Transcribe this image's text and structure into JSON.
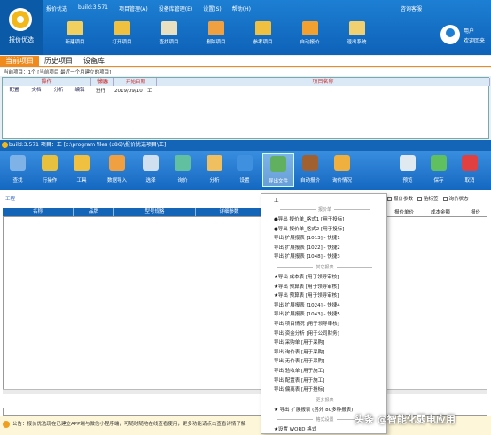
{
  "top_app": {
    "logo_text": "报价优选",
    "menu": [
      "报价优选",
      "build:3.571",
      "项目管理(A)",
      "设备库管理(E)",
      "设置(S)",
      "帮助(H)"
    ],
    "top_right": [
      "咨询客服"
    ],
    "toolbar": [
      "新建项目",
      "打开项目",
      "查找项目",
      "删除项目",
      "参考项目",
      "自动报价",
      "退出系统"
    ],
    "user_label": "用户",
    "user_greeting": "欢迎回来"
  },
  "tabs": [
    "当前项目",
    "历史项目",
    "设备库"
  ],
  "count_text": "当前项目：1个 [当前项目 最近一个月建立的项目]",
  "grid1": {
    "group_headers": [
      "操作",
      "状态",
      "项目名称"
    ],
    "sub_headers": [
      "配置",
      "文档",
      "分析",
      "编辑",
      "状态",
      "开始日期"
    ],
    "row": {
      "status": "进行",
      "date": "2019/09/10",
      "name": "工"
    }
  },
  "win2": {
    "title": "build:3.571  项目：工  [c:\\program files (x86)\\报价优选项目\\工]",
    "toolbar": [
      "查找",
      "行操作",
      "工具",
      "数据导入",
      "选择",
      "询价",
      "分析",
      "设置",
      "导出文件",
      "自动报价",
      "询价情况",
      "预览",
      "保存",
      "取消"
    ],
    "sub_label": "工程",
    "checks": [
      "报价参数",
      "贴标签",
      "询价状态"
    ],
    "grid_headers": [
      "名称",
      "品牌",
      "型号规格",
      "详细参数"
    ],
    "grid_headers_right": [
      "报价单价",
      "成本金额",
      "报价"
    ],
    "notice": "公告：报价优选现在已建立APP端与微信小程序端，可随时随地在线查看使用，更多功能请点击查看详情了解"
  },
  "dropdown": {
    "top_item": "工",
    "sections": [
      {
        "title": "报价单",
        "items": [
          "●导出 报价单_格式1 [用于投标]",
          "●导出 报价单_格式2 [用于投标]",
          "导出 扩展报表 [1013] - 快捷1",
          "导出 扩展报表 [1022] - 快捷2",
          "导出 扩展报表 [1048] - 快捷3"
        ]
      },
      {
        "title": "其它报表",
        "items": [
          "★导出 成本表 [用于领导审核]",
          "★导出 预算表 [用于领导审核]",
          "★导出 预算表 [用于领导审核]",
          "导出 扩展报表 [1024] - 快捷4",
          "导出 扩展报表 [1043] - 快捷5",
          "导出 项目情况 [用于领导审核]",
          "导出 资金分析 [用于公司财务]",
          "导出 采购单 [用于采购]",
          "导出 询价表 [用于采购]",
          "导出 无价表 [用于采购]",
          "导出 验收单 [用于施工]",
          "导出 配置表 [用于施工]",
          "导出 偏离表 [用于投标]"
        ]
      },
      {
        "title": "更多报表",
        "items": [
          "★ 导出 扩展报表 (另外 80多种报表)"
        ]
      },
      {
        "title": "格式设置",
        "items": [
          "★设置 WORD 格式"
        ]
      }
    ]
  },
  "watermark": "头条 @智能化弱电应用",
  "colors": {
    "primary": "#1464b8",
    "accent": "#f08a1c",
    "logo": "#f2b81a"
  }
}
